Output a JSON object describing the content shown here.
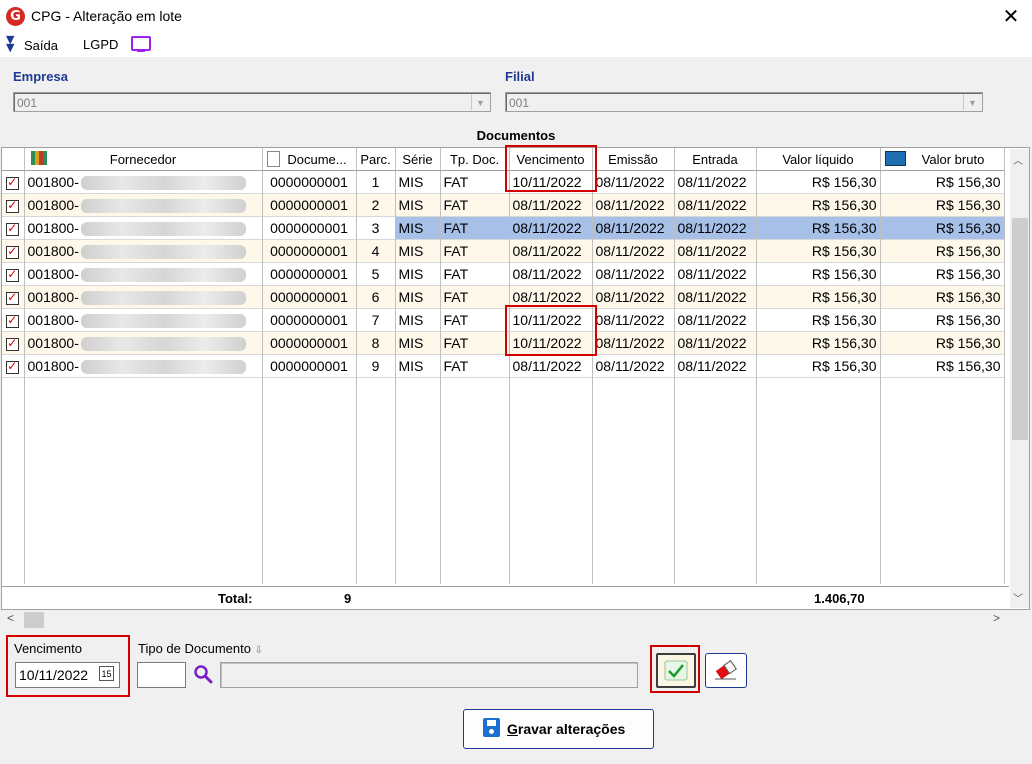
{
  "window": {
    "title": "CPG - Alteração em lote",
    "logo": "G",
    "close": "✕"
  },
  "menu": {
    "saida": "Saída",
    "lgpd": "LGPD"
  },
  "empresa": {
    "label": "Empresa",
    "value": "001"
  },
  "filial": {
    "label": "Filial",
    "value": "001"
  },
  "documents": {
    "caption": "Documentos",
    "columns": [
      "Fornecedor",
      "Docume...",
      "Parc.",
      "Série",
      "Tp. Doc.",
      "Vencimento",
      "Emissão",
      "Entrada",
      "Valor líquido",
      "Valor bruto"
    ],
    "rows": [
      {
        "fornecedor": "001800-",
        "documento": "0000000001",
        "parc": "1",
        "serie": "MIS",
        "tipo": "FAT",
        "vencimento": "10/11/2022",
        "emissao": "08/11/2022",
        "entrada": "08/11/2022",
        "liquido": "R$ 156,30",
        "bruto": "R$ 156,30"
      },
      {
        "fornecedor": "001800-",
        "documento": "0000000001",
        "parc": "2",
        "serie": "MIS",
        "tipo": "FAT",
        "vencimento": "08/11/2022",
        "emissao": "08/11/2022",
        "entrada": "08/11/2022",
        "liquido": "R$ 156,30",
        "bruto": "R$ 156,30"
      },
      {
        "fornecedor": "001800-",
        "documento": "0000000001",
        "parc": "3",
        "serie": "MIS",
        "tipo": "FAT",
        "vencimento": "08/11/2022",
        "emissao": "08/11/2022",
        "entrada": "08/11/2022",
        "liquido": "R$ 156,30",
        "bruto": "R$ 156,30"
      },
      {
        "fornecedor": "001800-",
        "documento": "0000000001",
        "parc": "4",
        "serie": "MIS",
        "tipo": "FAT",
        "vencimento": "08/11/2022",
        "emissao": "08/11/2022",
        "entrada": "08/11/2022",
        "liquido": "R$ 156,30",
        "bruto": "R$ 156,30"
      },
      {
        "fornecedor": "001800-",
        "documento": "0000000001",
        "parc": "5",
        "serie": "MIS",
        "tipo": "FAT",
        "vencimento": "08/11/2022",
        "emissao": "08/11/2022",
        "entrada": "08/11/2022",
        "liquido": "R$ 156,30",
        "bruto": "R$ 156,30"
      },
      {
        "fornecedor": "001800-",
        "documento": "0000000001",
        "parc": "6",
        "serie": "MIS",
        "tipo": "FAT",
        "vencimento": "08/11/2022",
        "emissao": "08/11/2022",
        "entrada": "08/11/2022",
        "liquido": "R$ 156,30",
        "bruto": "R$ 156,30"
      },
      {
        "fornecedor": "001800-",
        "documento": "0000000001",
        "parc": "7",
        "serie": "MIS",
        "tipo": "FAT",
        "vencimento": "10/11/2022",
        "emissao": "08/11/2022",
        "entrada": "08/11/2022",
        "liquido": "R$ 156,30",
        "bruto": "R$ 156,30"
      },
      {
        "fornecedor": "001800-",
        "documento": "0000000001",
        "parc": "8",
        "serie": "MIS",
        "tipo": "FAT",
        "vencimento": "10/11/2022",
        "emissao": "08/11/2022",
        "entrada": "08/11/2022",
        "liquido": "R$ 156,30",
        "bruto": "R$ 156,30"
      },
      {
        "fornecedor": "001800-",
        "documento": "0000000001",
        "parc": "9",
        "serie": "MIS",
        "tipo": "FAT",
        "vencimento": "08/11/2022",
        "emissao": "08/11/2022",
        "entrada": "08/11/2022",
        "liquido": "R$ 156,30",
        "bruto": "R$ 156,30"
      }
    ],
    "total_label": "Total:",
    "total_count": "9",
    "total_value": "1.406,70"
  },
  "form": {
    "vencimento_label": "Vencimento",
    "vencimento_value": "10/11/2022",
    "calendar_glyph": "15",
    "tipo_label": "Tipo de Documento",
    "save_label": "Gravar alterações"
  },
  "colors": {
    "accent": "#1f3a93",
    "selection": "#a7c0e8",
    "highlight": "#d40000"
  }
}
